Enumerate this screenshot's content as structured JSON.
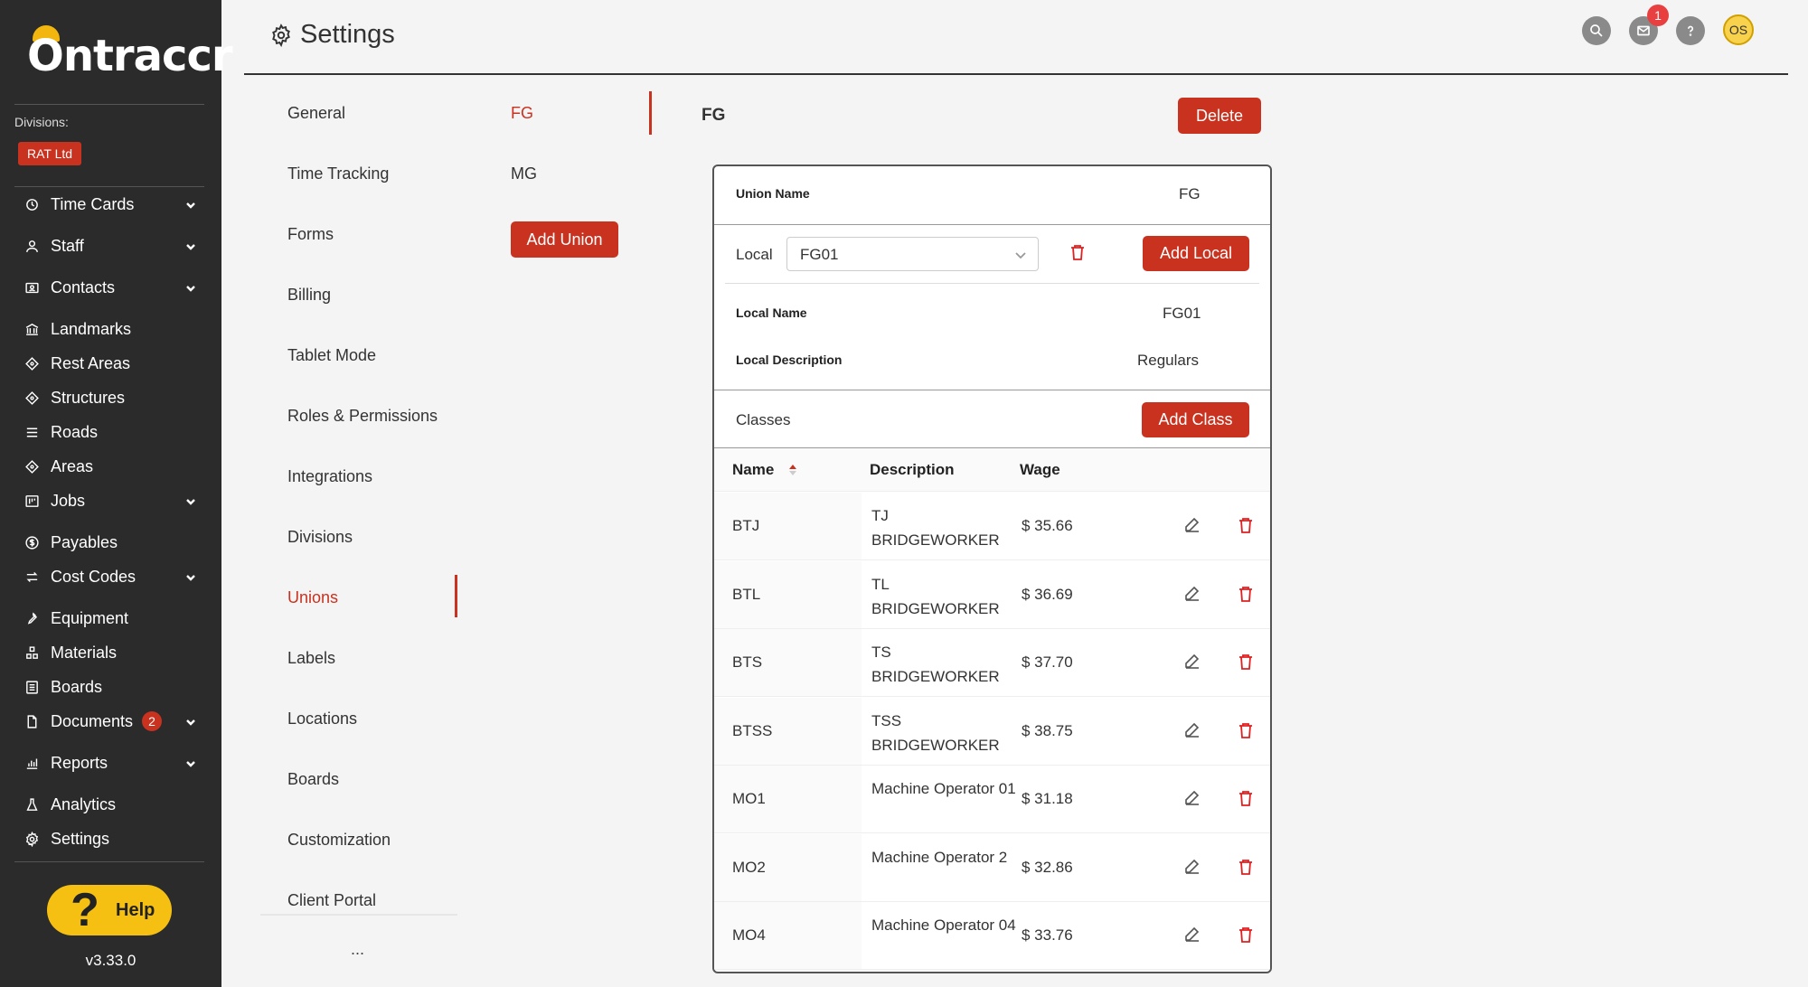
{
  "app": {
    "logo_text": "ntraccr",
    "version": "v3.33.0",
    "help_label": "Help"
  },
  "sidebar": {
    "divisions_label": "Divisions:",
    "division": "RAT Ltd",
    "items": [
      {
        "label": "Time Cards",
        "icon": "clock-icon",
        "chevron": true
      },
      {
        "label": "Staff",
        "icon": "user-icon",
        "chevron": true
      },
      {
        "label": "Contacts",
        "icon": "contact-card-icon",
        "chevron": true
      },
      {
        "label": "Landmarks",
        "icon": "bank-icon"
      },
      {
        "label": "Rest Areas",
        "icon": "diamond-icon"
      },
      {
        "label": "Structures",
        "icon": "diamond-icon"
      },
      {
        "label": "Roads",
        "icon": "lines-icon"
      },
      {
        "label": "Areas",
        "icon": "diamond-icon"
      },
      {
        "label": "Jobs",
        "icon": "board-icon",
        "chevron": true
      },
      {
        "label": "Payables",
        "icon": "dollar-icon"
      },
      {
        "label": "Cost Codes",
        "icon": "swap-icon",
        "chevron": true
      },
      {
        "label": "Equipment",
        "icon": "wrench-icon"
      },
      {
        "label": "Materials",
        "icon": "cubes-icon"
      },
      {
        "label": "Boards",
        "icon": "list-box-icon"
      },
      {
        "label": "Documents",
        "icon": "document-icon",
        "chevron": true,
        "badge": "2"
      },
      {
        "label": "Reports",
        "icon": "bar-chart-icon",
        "chevron": true
      },
      {
        "label": "Analytics",
        "icon": "flask-icon"
      },
      {
        "label": "Settings",
        "icon": "gear-icon"
      }
    ]
  },
  "header": {
    "title": "Settings",
    "mail_badge": "1",
    "avatar": "OS"
  },
  "settings_menu": {
    "items": [
      "General",
      "Time Tracking",
      "Forms",
      "Billing",
      "Tablet Mode",
      "Roles & Permissions",
      "Integrations",
      "Divisions",
      "Unions",
      "Labels",
      "Locations",
      "Boards",
      "Customization",
      "Client Portal"
    ],
    "active": "Unions",
    "more": "..."
  },
  "unions": {
    "items": [
      "FG",
      "MG"
    ],
    "active": "FG",
    "add_label": "Add Union"
  },
  "union_detail": {
    "title": "FG",
    "delete_label": "Delete",
    "union_name_label": "Union Name",
    "union_name_value": "FG",
    "local_label": "Local",
    "local_selected": "FG01",
    "add_local_label": "Add Local",
    "local_name_label": "Local Name",
    "local_name_value": "FG01",
    "local_desc_label": "Local Description",
    "local_desc_value": "Regulars",
    "classes_label": "Classes",
    "add_class_label": "Add Class",
    "table": {
      "columns": [
        "Name",
        "Description",
        "Wage"
      ],
      "rows": [
        {
          "name": "BTJ",
          "desc": "TJ BRIDGEWORKER",
          "wage": "$ 35.66"
        },
        {
          "name": "BTL",
          "desc": "TL BRIDGEWORKER",
          "wage": "$ 36.69"
        },
        {
          "name": "BTS",
          "desc": "TS BRIDGEWORKER",
          "wage": "$ 37.70"
        },
        {
          "name": "BTSS",
          "desc": "TSS BRIDGEWORKER",
          "wage": "$ 38.75"
        },
        {
          "name": "MO1",
          "desc": "Machine Operator 01",
          "wage": "$ 31.18"
        },
        {
          "name": "MO2",
          "desc": "Machine Operator 2",
          "wage": "$ 32.86"
        },
        {
          "name": "MO4",
          "desc": "Machine Operator 04",
          "wage": "$ 33.76"
        }
      ]
    }
  },
  "colors": {
    "accent": "#c8321f",
    "sidebar_bg": "#2b2b2b",
    "help_yellow": "#f6c013"
  }
}
